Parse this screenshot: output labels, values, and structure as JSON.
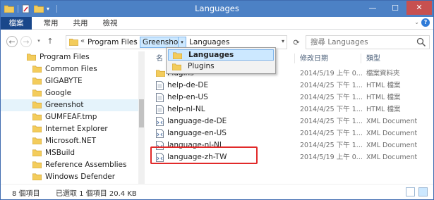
{
  "window": {
    "title": "Languages",
    "controls": {
      "minimize": "—",
      "maximize": "☐",
      "close": "✕"
    }
  },
  "ribbon": {
    "tabs": [
      "檔案",
      "常用",
      "共用",
      "檢視"
    ]
  },
  "address": {
    "overflow": "«",
    "crumbs": [
      "Program Files",
      "Greenshot",
      "Languages"
    ],
    "separator": "›",
    "dropdown_arrow": "▾"
  },
  "search": {
    "placeholder": "搜尋 Languages"
  },
  "navpane": {
    "items": [
      {
        "label": "Program Files",
        "indent": 0
      },
      {
        "label": "Common Files",
        "indent": 1
      },
      {
        "label": "GIGABYTE",
        "indent": 1
      },
      {
        "label": "Google",
        "indent": 1
      },
      {
        "label": "Greenshot",
        "indent": 1,
        "selected": true
      },
      {
        "label": "GUMFEAF.tmp",
        "indent": 1
      },
      {
        "label": "Internet Explorer",
        "indent": 1
      },
      {
        "label": "Microsoft.NET",
        "indent": 1
      },
      {
        "label": "MSBuild",
        "indent": 1
      },
      {
        "label": "Reference Assemblies",
        "indent": 1
      },
      {
        "label": "Windows Defender",
        "indent": 1
      }
    ]
  },
  "columns": {
    "name": "名",
    "date": "修改日期",
    "type": "類型"
  },
  "files": [
    {
      "name": "Plugins",
      "date": "2014/5/19 上午 0...",
      "type": "檔案資料夾",
      "icon": "folder-icon"
    },
    {
      "name": "help-de-DE",
      "date": "2014/4/25 下午 1...",
      "type": "HTML 檔案",
      "icon": "document-icon"
    },
    {
      "name": "help-en-US",
      "date": "2014/4/25 下午 1...",
      "type": "HTML 檔案",
      "icon": "document-icon"
    },
    {
      "name": "help-nl-NL",
      "date": "2014/4/25 下午 1...",
      "type": "HTML 檔案",
      "icon": "document-icon"
    },
    {
      "name": "language-de-DE",
      "date": "2014/4/25 下午 1...",
      "type": "XML Document",
      "icon": "xml-icon"
    },
    {
      "name": "language-en-US",
      "date": "2014/4/25 下午 1...",
      "type": "XML Document",
      "icon": "xml-icon"
    },
    {
      "name": "language-nl-NL",
      "date": "2014/4/25 下午 1...",
      "type": "XML Document",
      "icon": "xml-icon"
    },
    {
      "name": "language-zh-TW",
      "date": "2014/5/19 上午 0...",
      "type": "XML Document",
      "icon": "xml-icon",
      "highlighted": true
    }
  ],
  "popup": {
    "items": [
      {
        "label": "Languages",
        "selected": true
      },
      {
        "label": "Plugins",
        "selected": false
      }
    ]
  },
  "status": {
    "count": "8 個項目",
    "selection": "已選取 1 個項目  20.4 KB"
  },
  "colors": {
    "titlebar": "#4c81c5",
    "file_tab": "#19478a",
    "selection": "#cce8ff",
    "highlight_border": "#e12a2a",
    "folder": "#e8b84a"
  }
}
